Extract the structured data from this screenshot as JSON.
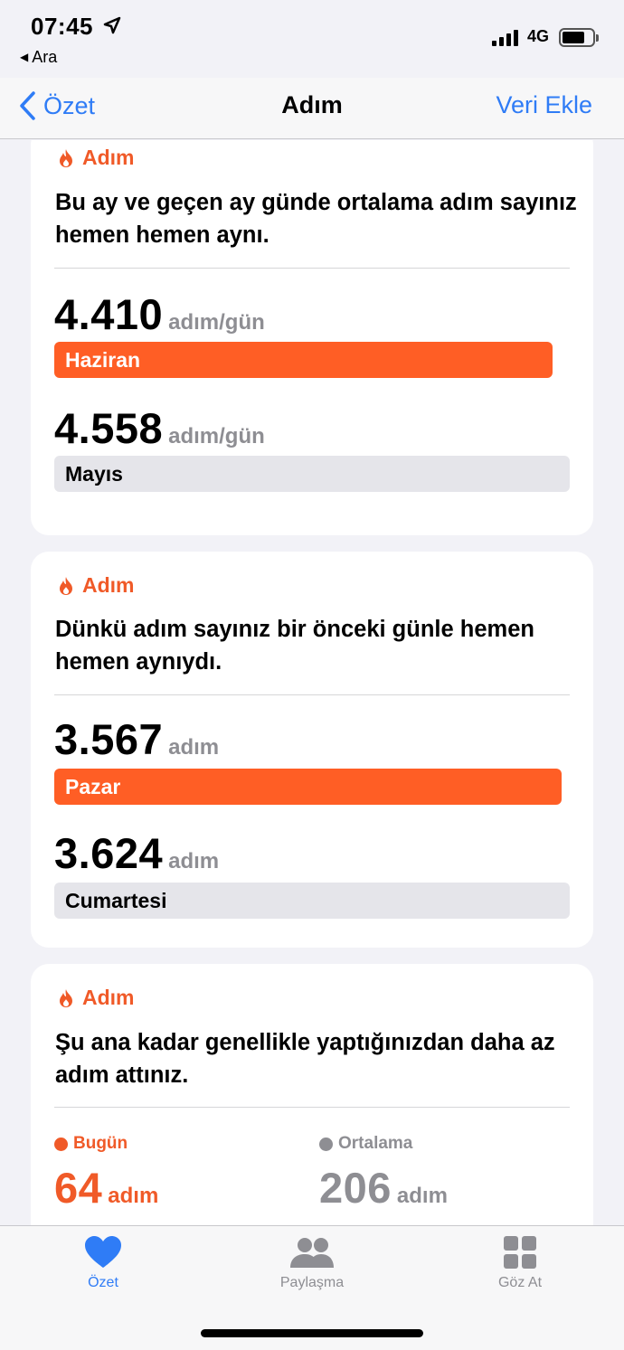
{
  "status_bar": {
    "time": "07:45",
    "back_app": "Ara",
    "network": "4G"
  },
  "nav": {
    "back_label": "Özet",
    "title": "Adım",
    "action_label": "Veri Ekle"
  },
  "cards": [
    {
      "category": "Adım",
      "text": "Bu ay ve geçen ay günde ortalama adım sayınız hemen hemen aynı.",
      "current": {
        "value": "4.410",
        "unit": "adım/gün",
        "label": "Haziran",
        "fraction": 0.967
      },
      "previous": {
        "value": "4.558",
        "unit": "adım/gün",
        "label": "Mayıs",
        "fraction": 1.0
      }
    },
    {
      "category": "Adım",
      "text": "Dünkü adım sayınız bir önceki günle hemen hemen aynıydı.",
      "current": {
        "value": "3.567",
        "unit": "adım",
        "label": "Pazar",
        "fraction": 0.984
      },
      "previous": {
        "value": "3.624",
        "unit": "adım",
        "label": "Cumartesi",
        "fraction": 1.0
      }
    },
    {
      "category": "Adım",
      "text": "Şu ana kadar genellikle yaptığınızdan daha az adım attınız.",
      "today": {
        "legend": "Bugün",
        "value": "64",
        "unit": "adım"
      },
      "average": {
        "legend": "Ortalama",
        "value": "206",
        "unit": "adım"
      }
    }
  ],
  "tabs": [
    {
      "label": "Özet",
      "icon": "heart-icon",
      "active": true
    },
    {
      "label": "Paylaşma",
      "icon": "people-icon",
      "active": false
    },
    {
      "label": "Göz At",
      "icon": "grid-icon",
      "active": false
    }
  ],
  "colors": {
    "accent": "#ff5e25",
    "link": "#2f7cf6",
    "muted": "#8e8e93"
  }
}
